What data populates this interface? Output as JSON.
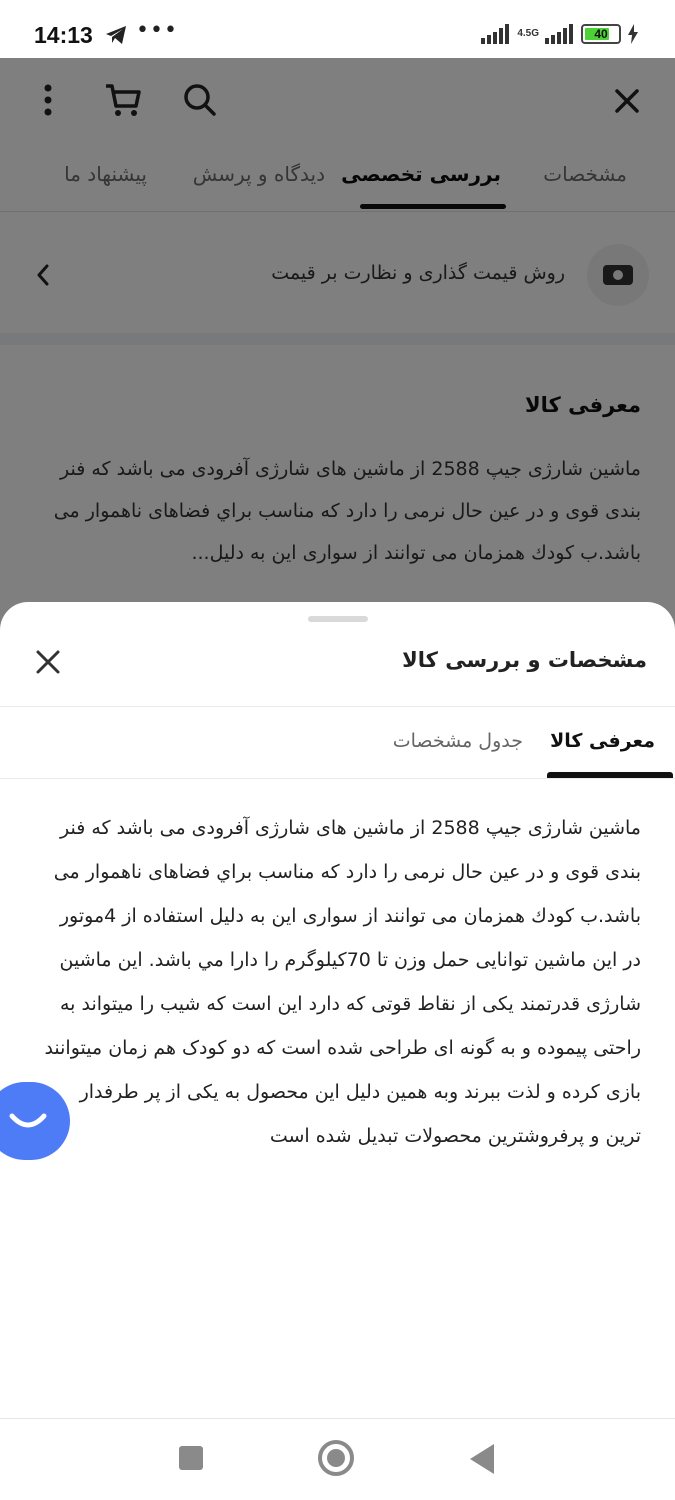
{
  "status_bar": {
    "time": "14:13",
    "network": "4.5G",
    "battery": "40",
    "icons": [
      "telegram-icon",
      "more-dots-icon",
      "signal-icon",
      "battery-icon",
      "charging-icon"
    ]
  },
  "header": {
    "icons": [
      "more-vertical-icon",
      "cart-icon",
      "search-icon",
      "close-icon"
    ]
  },
  "page_tabs": {
    "items": [
      {
        "label": "مشخصات"
      },
      {
        "label": "بررسی تخصصی"
      },
      {
        "label": "دیدگاه و پرسش"
      },
      {
        "label": "پیشنهاد ما"
      }
    ],
    "active_index": 1
  },
  "price_row": {
    "label": "روش قیمت گذاری و نظارت بر قیمت",
    "icon": "money-icon",
    "chevron": "chevron-left-icon"
  },
  "intro_bg": {
    "title": "معرفی کالا",
    "text": "ماشین شارژی جیپ 2588 از ماشین های شارژی آفرودی می باشد که فنر بندی قوی و در عین حال نرمی را دارد که مناسب براي فضاهای ناهموار می باشد.ب کودك همزمان می توانند از سواری این به دلیل..."
  },
  "sheet": {
    "title": "مشخصات و بررسی کالا",
    "tabs": [
      {
        "label": "معرفی کالا"
      },
      {
        "label": "جدول مشخصات"
      }
    ],
    "active_tab": 0,
    "body": "ماشین شارژی جیپ 2588 از ماشین های شارژی آفرودی می باشد که فنر بندی قوی و در عین حال نرمی را دارد که مناسب براي فضاهای ناهموار می باشد.ب کودك همزمان می توانند از سواری این به دلیل استفاده از 4موتور در این ماشین توانایی حمل وزن تا 70کیلوگرم را دارا مي باشد. این ماشین شارژی قدرتمند یکی از نقاط قوتی که دارد این است که شیب را میتواند به راحتی پیموده و به گونه ای طراحی شده است که دو کودک هم زمان میتوانند بازی کرده و لذت ببرند وبه همین دلیل این محصول به یکی از پر طرفدار ترین و پرفروشترین محصولات تبدیل شده است"
  },
  "colors": {
    "accent_blue": "#4d7cf6",
    "overlay": "rgba(0,0,0,0.5)",
    "battery_green": "#4cd137"
  }
}
